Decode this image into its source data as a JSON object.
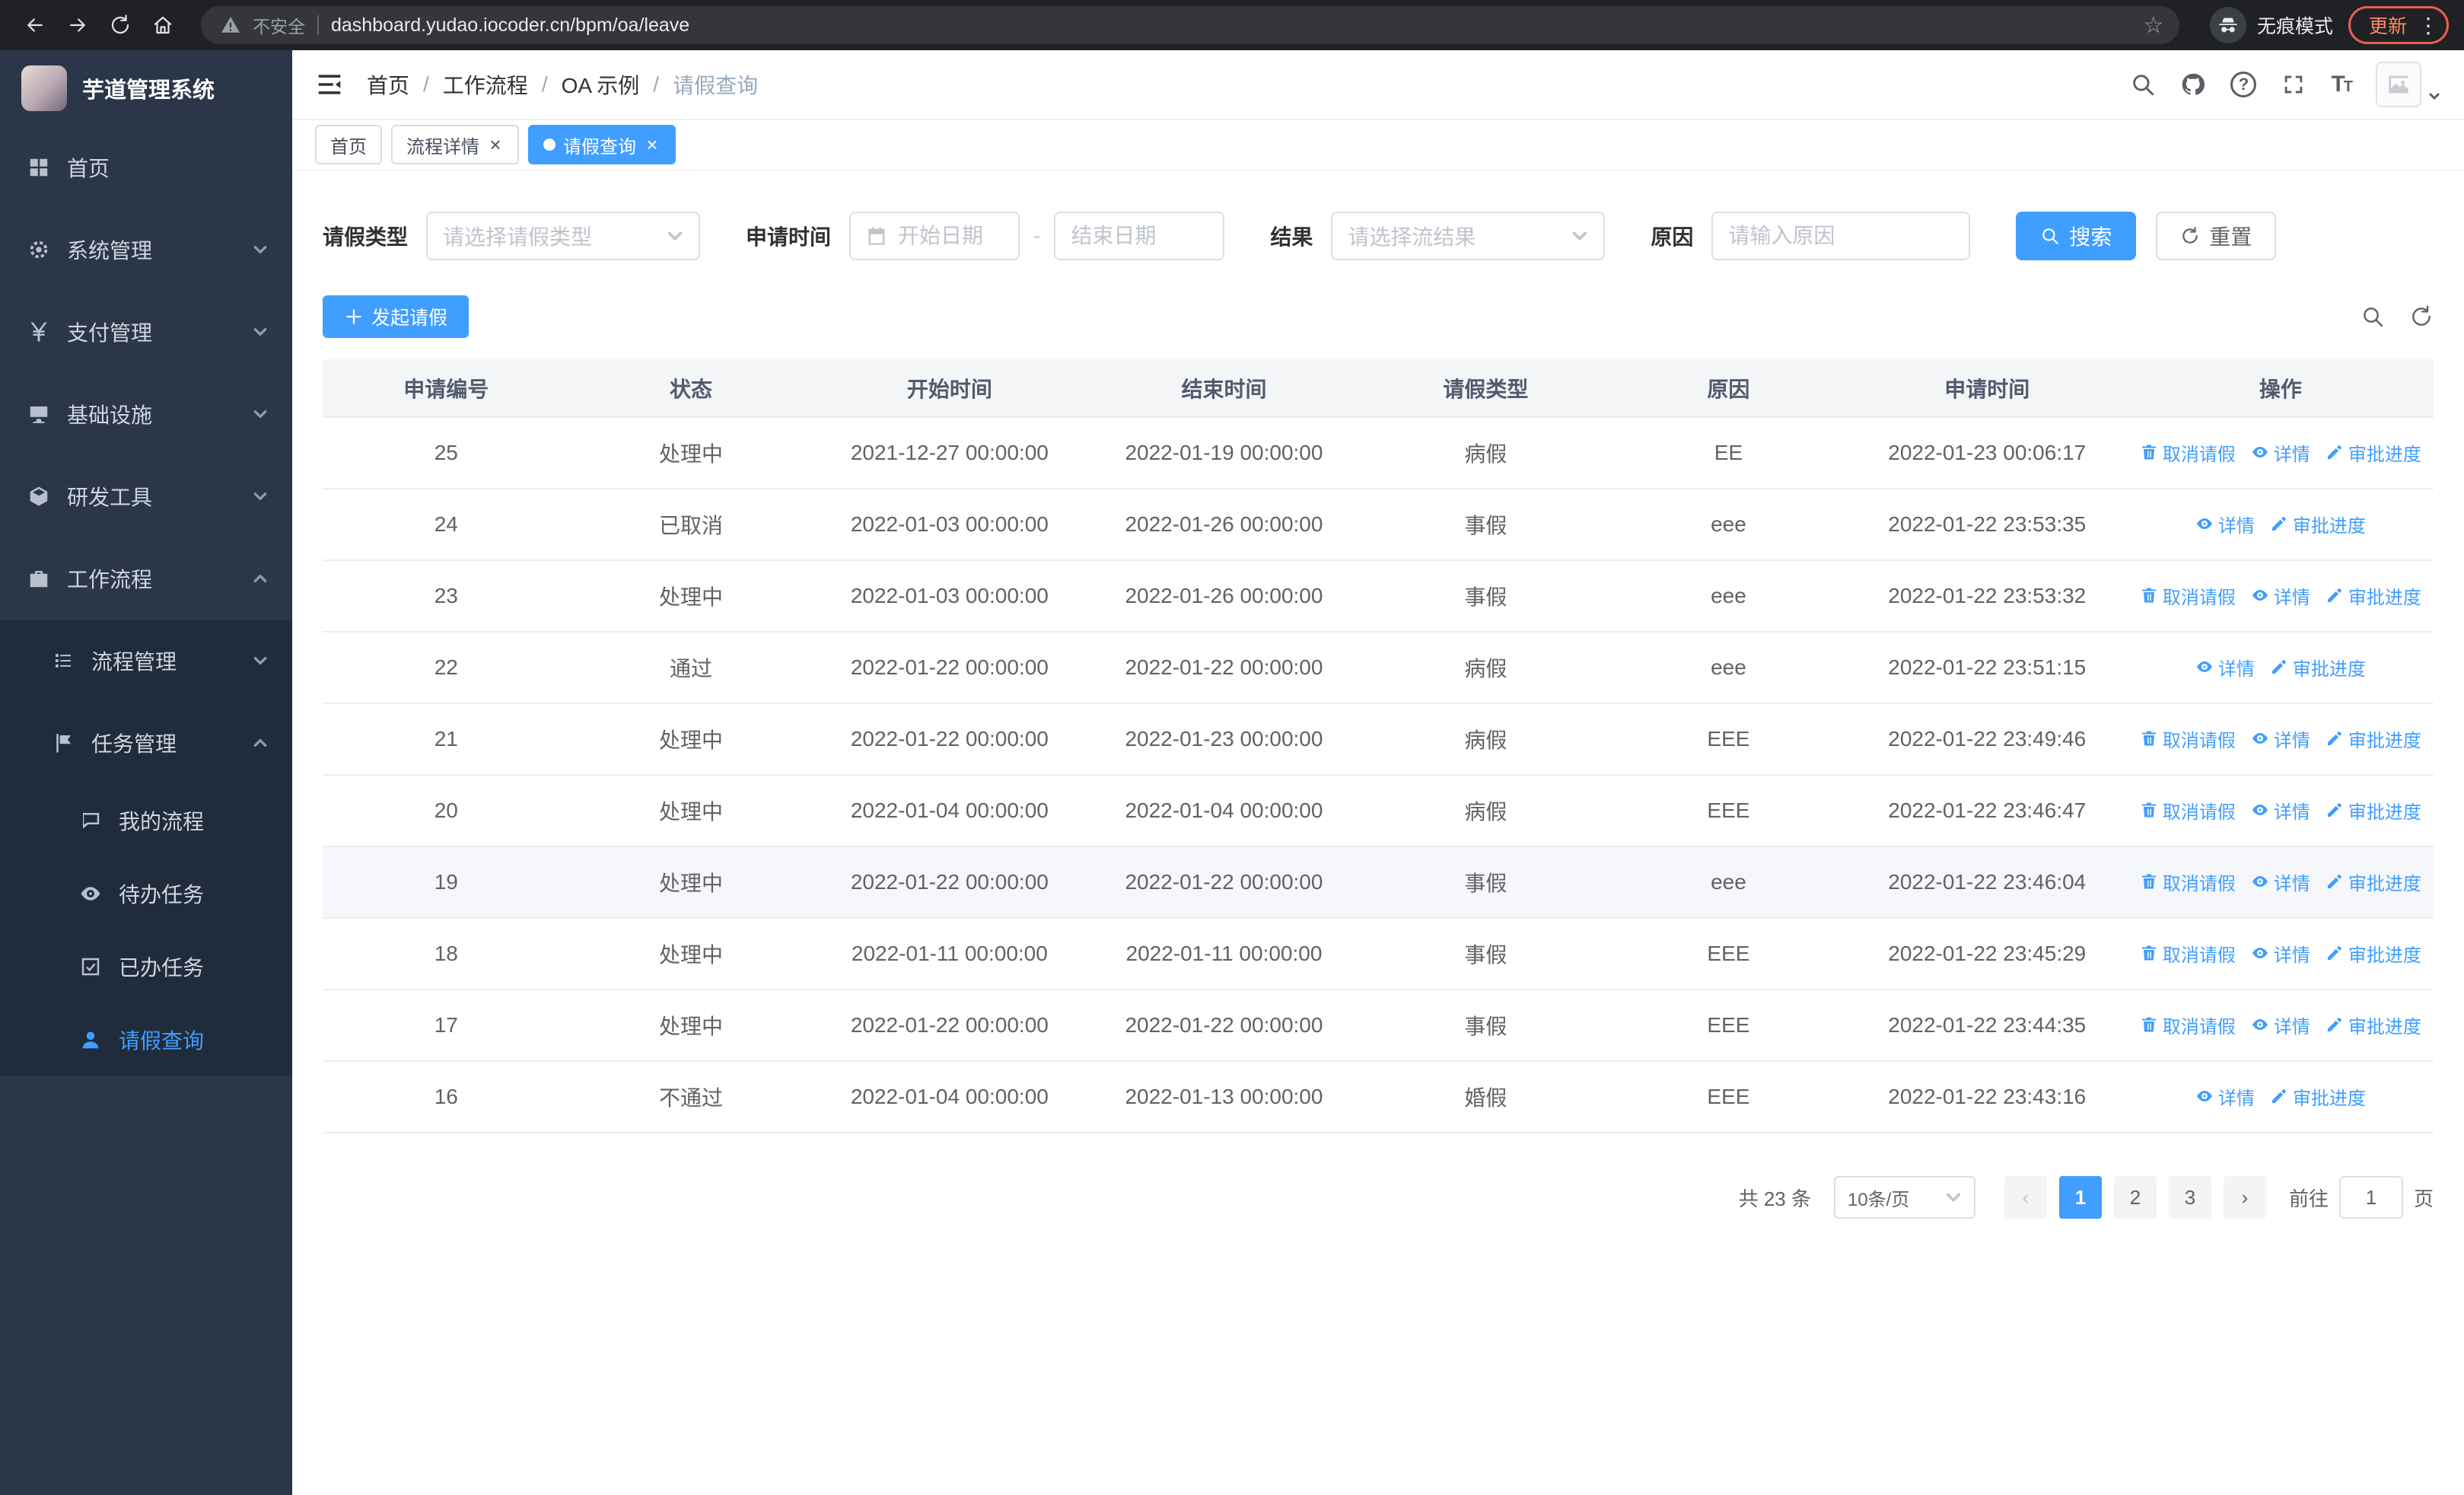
{
  "colors": {
    "primary": "#409eff",
    "sidebar_bg": "#2b3648",
    "sidebar_sub_bg": "#202b3b",
    "chrome_bg": "#202124"
  },
  "browser": {
    "security_label": "不安全",
    "url": "dashboard.yudao.iocoder.cn/bpm/oa/leave",
    "incognito_label": "无痕模式",
    "update_label": "更新"
  },
  "sidebar": {
    "title": "芋道管理系统",
    "items": [
      {
        "label": "首页",
        "icon": "dashboard-icon"
      },
      {
        "label": "系统管理",
        "icon": "gear-icon"
      },
      {
        "label": "支付管理",
        "icon": "yen-icon"
      },
      {
        "label": "基础设施",
        "icon": "infrastructure-icon"
      },
      {
        "label": "研发工具",
        "icon": "tools-icon"
      },
      {
        "label": "工作流程",
        "icon": "workflow-icon",
        "expanded": true
      }
    ],
    "submenu": [
      {
        "label": "流程管理",
        "icon": "list-icon"
      },
      {
        "label": "任务管理",
        "icon": "flag-icon",
        "expanded": true
      }
    ],
    "task_items": [
      {
        "label": "我的流程",
        "icon": "chat-icon"
      },
      {
        "label": "待办任务",
        "icon": "eye-icon"
      },
      {
        "label": "已办任务",
        "icon": "done-icon"
      },
      {
        "label": "请假查询",
        "icon": "user-icon",
        "active": true
      }
    ]
  },
  "breadcrumb": {
    "separator": "/",
    "items": [
      "首页",
      "工作流程",
      "OA 示例",
      "请假查询"
    ]
  },
  "tabs": [
    {
      "label": "首页",
      "closable": false,
      "active": false
    },
    {
      "label": "流程详情",
      "closable": true,
      "active": false
    },
    {
      "label": "请假查询",
      "closable": true,
      "active": true
    }
  ],
  "filters": {
    "leave_type_label": "请假类型",
    "leave_type_placeholder": "请选择请假类型",
    "apply_time_label": "申请时间",
    "start_date_placeholder": "开始日期",
    "range_separator": "-",
    "end_date_placeholder": "结束日期",
    "result_label": "结果",
    "result_placeholder": "请选择流结果",
    "reason_label": "原因",
    "reason_placeholder": "请输入原因",
    "search_button": "搜索",
    "reset_button": "重置"
  },
  "toolbar": {
    "create_label": "发起请假"
  },
  "table": {
    "columns": [
      "申请编号",
      "状态",
      "开始时间",
      "结束时间",
      "请假类型",
      "原因",
      "申请时间",
      "操作"
    ],
    "column_keys": [
      "id",
      "status",
      "start",
      "end",
      "type",
      "reason",
      "apply_time"
    ],
    "action_defs": {
      "cancel": {
        "label": "取消请假",
        "icon": "delete-icon",
        "name": "cancel-leave-link"
      },
      "detail": {
        "label": "详情",
        "icon": "view-icon",
        "name": "detail-link"
      },
      "progress": {
        "label": "审批进度",
        "icon": "edit-icon",
        "name": "approval-progress-link"
      }
    },
    "rows": [
      {
        "id": "25",
        "status": "处理中",
        "start": "2021-12-27 00:00:00",
        "end": "2022-01-19 00:00:00",
        "type": "病假",
        "reason": "EE",
        "apply_time": "2022-01-23 00:06:17",
        "actions": [
          "cancel",
          "detail",
          "progress"
        ]
      },
      {
        "id": "24",
        "status": "已取消",
        "start": "2022-01-03 00:00:00",
        "end": "2022-01-26 00:00:00",
        "type": "事假",
        "reason": "eee",
        "apply_time": "2022-01-22 23:53:35",
        "actions": [
          "detail",
          "progress"
        ]
      },
      {
        "id": "23",
        "status": "处理中",
        "start": "2022-01-03 00:00:00",
        "end": "2022-01-26 00:00:00",
        "type": "事假",
        "reason": "eee",
        "apply_time": "2022-01-22 23:53:32",
        "actions": [
          "cancel",
          "detail",
          "progress"
        ]
      },
      {
        "id": "22",
        "status": "通过",
        "start": "2022-01-22 00:00:00",
        "end": "2022-01-22 00:00:00",
        "type": "病假",
        "reason": "eee",
        "apply_time": "2022-01-22 23:51:15",
        "actions": [
          "detail",
          "progress"
        ]
      },
      {
        "id": "21",
        "status": "处理中",
        "start": "2022-01-22 00:00:00",
        "end": "2022-01-23 00:00:00",
        "type": "病假",
        "reason": "EEE",
        "apply_time": "2022-01-22 23:49:46",
        "actions": [
          "cancel",
          "detail",
          "progress"
        ]
      },
      {
        "id": "20",
        "status": "处理中",
        "start": "2022-01-04 00:00:00",
        "end": "2022-01-04 00:00:00",
        "type": "病假",
        "reason": "EEE",
        "apply_time": "2022-01-22 23:46:47",
        "actions": [
          "cancel",
          "detail",
          "progress"
        ]
      },
      {
        "id": "19",
        "status": "处理中",
        "start": "2022-01-22 00:00:00",
        "end": "2022-01-22 00:00:00",
        "type": "事假",
        "reason": "eee",
        "apply_time": "2022-01-22 23:46:04",
        "actions": [
          "cancel",
          "detail",
          "progress"
        ],
        "highlighted": true
      },
      {
        "id": "18",
        "status": "处理中",
        "start": "2022-01-11 00:00:00",
        "end": "2022-01-11 00:00:00",
        "type": "事假",
        "reason": "EEE",
        "apply_time": "2022-01-22 23:45:29",
        "actions": [
          "cancel",
          "detail",
          "progress"
        ]
      },
      {
        "id": "17",
        "status": "处理中",
        "start": "2022-01-22 00:00:00",
        "end": "2022-01-22 00:00:00",
        "type": "事假",
        "reason": "EEE",
        "apply_time": "2022-01-22 23:44:35",
        "actions": [
          "cancel",
          "detail",
          "progress"
        ]
      },
      {
        "id": "16",
        "status": "不通过",
        "start": "2022-01-04 00:00:00",
        "end": "2022-01-13 00:00:00",
        "type": "婚假",
        "reason": "EEE",
        "apply_time": "2022-01-22 23:43:16",
        "actions": [
          "detail",
          "progress"
        ]
      }
    ]
  },
  "pagination": {
    "total_label": "共 23 条",
    "page_size_label": "10条/页",
    "pages": [
      "1",
      "2",
      "3"
    ],
    "active_page": "1",
    "goto_prefix": "前往",
    "goto_value": "1",
    "goto_suffix": "页"
  }
}
